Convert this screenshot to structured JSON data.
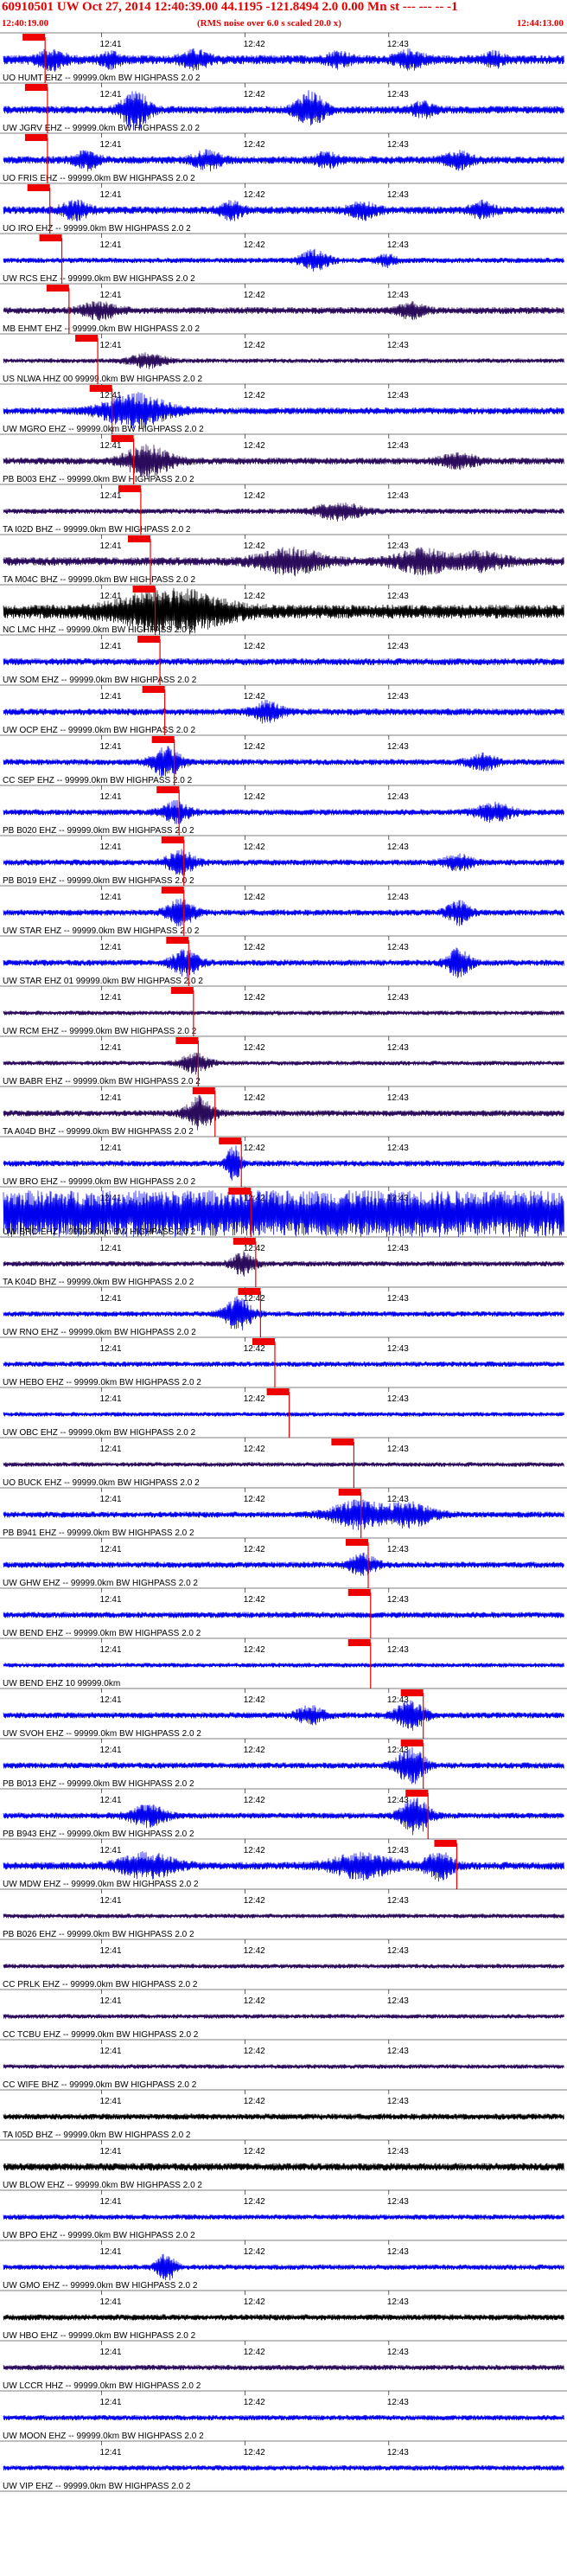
{
  "header": {
    "title": "60910501 UW Oct 27, 2014 12:40:39.00   44.1195 -121.8494  2.0 0.00 Mn st --- --- -- -1",
    "start_time": "12:40:19.00",
    "rms_note": "(RMS noise over 6.0 s scaled 20.0 x)",
    "end_time": "12:44:13.00"
  },
  "colors": {
    "blue_trace": "#0000ee",
    "purple_trace": "#2a0a5a",
    "black_trace": "#000000",
    "pick_red": "#ee0000",
    "label_text": "#000000"
  },
  "chart_data": {
    "type": "seismogram",
    "time_range": [
      "12:40:19.00",
      "12:44:13.00"
    ],
    "tick_labels": [
      "12:41",
      "12:42",
      "12:43"
    ],
    "tick_times_sec": [
      41,
      101,
      161
    ],
    "total_seconds": 234,
    "origin_time": "12:40:39.00",
    "traces": [
      {
        "label": "UO HUMT EHZ -- 99999.0km BW HIGHPASS  2.0  2",
        "color": "blue",
        "pick_sec": 8,
        "amplitude": 0.6,
        "bursts": [
          [
            20,
            6,
            1.0
          ],
          [
            45,
            4,
            0.8
          ],
          [
            80,
            6,
            0.9
          ],
          [
            140,
            5,
            0.8
          ],
          [
            170,
            6,
            0.9
          ],
          [
            205,
            4,
            0.7
          ]
        ]
      },
      {
        "label": "UW JGRV EHZ -- 99999.0km BW HIGHPASS  2.0  2",
        "color": "blue",
        "pick_sec": 9,
        "amplitude": 0.5,
        "bursts": [
          [
            55,
            6,
            2.2
          ],
          [
            128,
            6,
            2.2
          ],
          [
            175,
            5,
            0.8
          ]
        ]
      },
      {
        "label": "UO FRIS EHZ -- 99999.0km BW HIGHPASS  2.0  2",
        "color": "blue",
        "pick_sec": 9,
        "amplitude": 0.5,
        "bursts": [
          [
            35,
            5,
            1.0
          ],
          [
            85,
            6,
            1.0
          ],
          [
            135,
            5,
            0.8
          ],
          [
            190,
            6,
            0.9
          ]
        ]
      },
      {
        "label": "UO IRO EHZ -- 99999.0km BW HIGHPASS  2.0  2",
        "color": "blue",
        "pick_sec": 10,
        "amplitude": 0.5,
        "bursts": [
          [
            30,
            6,
            1.0
          ],
          [
            95,
            5,
            1.0
          ],
          [
            150,
            6,
            0.9
          ],
          [
            200,
            5,
            0.9
          ]
        ]
      },
      {
        "label": "UW RCS EHZ -- 99999.0km BW HIGHPASS  2.0  2",
        "color": "blue",
        "pick_sec": 15,
        "amplitude": 0.35,
        "bursts": [
          [
            130,
            6,
            1.2
          ],
          [
            160,
            4,
            0.7
          ]
        ]
      },
      {
        "label": "MB EHMT EHZ -- 99999.0km BW HIGHPASS  2.0  2",
        "color": "purple",
        "pick_sec": 18,
        "amplitude": 0.45,
        "bursts": [
          [
            40,
            8,
            0.9
          ],
          [
            170,
            6,
            0.8
          ]
        ]
      },
      {
        "label": "US NLWA HHZ 00 99999.0km BW HIGHPASS  2.0  2",
        "color": "purple",
        "pick_sec": 30,
        "amplitude": 0.3,
        "bursts": [
          [
            60,
            8,
            0.8
          ]
        ]
      },
      {
        "label": "UW MGRO EHZ -- 99999.0km BW HIGHPASS  2.0  2",
        "color": "blue",
        "pick_sec": 36,
        "amplitude": 0.45,
        "bursts": [
          [
            55,
            14,
            2.0
          ]
        ]
      },
      {
        "label": "PB B003 EHZ -- 99999.0km BW HIGHPASS  2.0  2",
        "color": "purple",
        "pick_sec": 45,
        "amplitude": 0.45,
        "bursts": [
          [
            60,
            10,
            1.8
          ],
          [
            190,
            8,
            0.8
          ]
        ]
      },
      {
        "label": "TA I02D BHZ -- 99999.0km BW HIGHPASS  2.0  2",
        "color": "purple",
        "pick_sec": 48,
        "amplitude": 0.35,
        "bursts": [
          [
            140,
            10,
            1.0
          ]
        ]
      },
      {
        "label": "TA M04C BHZ -- 99999.0km BW HIGHPASS  2.0  2",
        "color": "purple",
        "pick_sec": 52,
        "amplitude": 0.55,
        "bursts": [
          [
            120,
            14,
            1.4
          ],
          [
            175,
            12,
            1.3
          ],
          [
            200,
            10,
            1.0
          ]
        ]
      },
      {
        "label": "NC LMC HHZ -- 99999.0km BW HIGHPASS  2.0  2",
        "color": "black",
        "pick_sec": 54,
        "amplitude": 0.9,
        "bursts": [
          [
            70,
            22,
            2.4
          ]
        ]
      },
      {
        "label": "UW SOM EHZ -- 99999.0km BW HIGHPASS  2.0  2",
        "color": "blue",
        "pick_sec": 56,
        "amplitude": 0.45,
        "bursts": []
      },
      {
        "label": "UW OCP EHZ -- 99999.0km BW HIGHPASS  2.0  2",
        "color": "blue",
        "pick_sec": 58,
        "amplitude": 0.45,
        "bursts": [
          [
            110,
            6,
            1.2
          ]
        ]
      },
      {
        "label": "CC SEP EHZ -- 99999.0km BW HIGHPASS  2.0  2",
        "color": "blue",
        "pick_sec": 62,
        "amplitude": 0.4,
        "bursts": [
          [
            68,
            6,
            1.8
          ],
          [
            200,
            6,
            0.9
          ]
        ]
      },
      {
        "label": "PB B020 EHZ -- 99999.0km BW HIGHPASS  2.0  2",
        "color": "blue",
        "pick_sec": 64,
        "amplitude": 0.4,
        "bursts": [
          [
            72,
            6,
            1.2
          ],
          [
            205,
            8,
            1.0
          ]
        ]
      },
      {
        "label": "PB B019 EHZ -- 99999.0km BW HIGHPASS  2.0  2",
        "color": "blue",
        "pick_sec": 66,
        "amplitude": 0.4,
        "bursts": [
          [
            74,
            6,
            1.4
          ],
          [
            190,
            6,
            0.9
          ]
        ]
      },
      {
        "label": "UW STAR EHZ -- 99999.0km BW HIGHPASS  2.0  2",
        "color": "blue",
        "pick_sec": 66,
        "amplitude": 0.4,
        "bursts": [
          [
            74,
            6,
            1.5
          ],
          [
            190,
            5,
            1.4
          ]
        ]
      },
      {
        "label": "UW STAR EHZ 01 99999.0km BW HIGHPASS  2.0  2",
        "color": "blue",
        "pick_sec": 68,
        "amplitude": 0.4,
        "bursts": [
          [
            76,
            6,
            1.5
          ],
          [
            190,
            5,
            1.6
          ]
        ]
      },
      {
        "label": "UW RCM EHZ -- 99999.0km BW HIGHPASS  2.0  2",
        "color": "purple",
        "pick_sec": 70,
        "amplitude": 0.3,
        "bursts": []
      },
      {
        "label": "UW BABR EHZ -- 99999.0km BW HIGHPASS  2.0  2",
        "color": "purple",
        "pick_sec": 72,
        "amplitude": 0.3,
        "bursts": [
          [
            80,
            6,
            1.2
          ]
        ]
      },
      {
        "label": "TA A04D BHZ -- 99999.0km BW HIGHPASS  2.0  2",
        "color": "purple",
        "pick_sec": 79,
        "amplitude": 0.4,
        "bursts": [
          [
            82,
            6,
            2.0
          ]
        ]
      },
      {
        "label": "UW BRO EHZ -- 99999.0km BW HIGHPASS  2.0  2",
        "color": "blue",
        "pick_sec": 90,
        "amplitude": 0.4,
        "bursts": [
          [
            96,
            3,
            2.2
          ]
        ]
      },
      {
        "label": "UW BRO EHZ -- 99999.0km BW HIGHPASS  2.0  2",
        "color": "blue",
        "pick_sec": 94,
        "amplitude": 3.0,
        "bursts": []
      },
      {
        "label": "TA K04D BHZ -- 99999.0km BW HIGHPASS  2.0  2",
        "color": "purple",
        "pick_sec": 96,
        "amplitude": 0.35,
        "bursts": [
          [
            100,
            5,
            1.3
          ]
        ]
      },
      {
        "label": "UW RNO EHZ -- 99999.0km BW HIGHPASS  2.0  2",
        "color": "blue",
        "pick_sec": 98,
        "amplitude": 0.35,
        "bursts": [
          [
            98,
            6,
            2.0
          ]
        ]
      },
      {
        "label": "UW HEBO EHZ -- 99999.0km BW HIGHPASS  2.0  2",
        "color": "blue",
        "pick_sec": 104,
        "amplitude": 0.35,
        "bursts": []
      },
      {
        "label": "UW OBC EHZ -- 99999.0km BW HIGHPASS  2.0  2",
        "color": "blue",
        "pick_sec": 110,
        "amplitude": 0.3,
        "bursts": []
      },
      {
        "label": "UO BUCK EHZ -- 99999.0km BW HIGHPASS  2.0  2",
        "color": "purple",
        "pick_sec": 137,
        "amplitude": 0.3,
        "bursts": []
      },
      {
        "label": "PB B941 EHZ -- 99999.0km BW HIGHPASS  2.0  2",
        "color": "blue",
        "pick_sec": 140,
        "amplitude": 0.4,
        "bursts": [
          [
            148,
            12,
            1.6
          ],
          [
            170,
            10,
            1.4
          ]
        ]
      },
      {
        "label": "UW GHW EHZ -- 99999.0km BW HIGHPASS  2.0  2",
        "color": "blue",
        "pick_sec": 143,
        "amplitude": 0.4,
        "bursts": [
          [
            150,
            6,
            1.2
          ]
        ]
      },
      {
        "label": "UW BEND EHZ -- 99999.0km BW HIGHPASS  2.0  2",
        "color": "blue",
        "pick_sec": 144,
        "amplitude": 0.4,
        "bursts": []
      },
      {
        "label": "UW BEND EHZ 10 99999.0km",
        "color": "blue",
        "pick_sec": 144,
        "amplitude": 0.3,
        "bursts": []
      },
      {
        "label": "UW SVOH EHZ -- 99999.0km BW HIGHPASS  2.0  2",
        "color": "blue",
        "pick_sec": 166,
        "amplitude": 0.4,
        "bursts": [
          [
            128,
            6,
            1.0
          ],
          [
            170,
            6,
            1.8
          ]
        ]
      },
      {
        "label": "PB B013 EHZ -- 99999.0km BW HIGHPASS  2.0  2",
        "color": "blue",
        "pick_sec": 166,
        "amplitude": 0.4,
        "bursts": [
          [
            170,
            6,
            2.2
          ]
        ]
      },
      {
        "label": "PB B943 EHZ -- 99999.0km BW HIGHPASS  2.0  2",
        "color": "blue",
        "pick_sec": 168,
        "amplitude": 0.4,
        "bursts": [
          [
            60,
            8,
            1.2
          ],
          [
            172,
            6,
            2.2
          ]
        ]
      },
      {
        "label": "UW MDW EHZ -- 99999.0km BW HIGHPASS  2.0  2",
        "color": "blue",
        "pick_sec": 180,
        "amplitude": 0.5,
        "bursts": [
          [
            60,
            12,
            1.4
          ],
          [
            150,
            14,
            1.4
          ],
          [
            182,
            6,
            1.6
          ]
        ]
      },
      {
        "label": "PB B026 EHZ -- 99999.0km BW HIGHPASS  2.0  2",
        "color": "purple",
        "pick_sec": -1,
        "amplitude": 0.3,
        "bursts": []
      },
      {
        "label": "CC PRLK EHZ -- 99999.0km BW HIGHPASS  2.0  2",
        "color": "purple",
        "pick_sec": -1,
        "amplitude": 0.3,
        "bursts": []
      },
      {
        "label": "CC TCBU EHZ -- 99999.0km BW HIGHPASS  2.0  2",
        "color": "purple",
        "pick_sec": -1,
        "amplitude": 0.3,
        "bursts": []
      },
      {
        "label": "CC WIFE BHZ -- 99999.0km BW HIGHPASS  2.0  2",
        "color": "purple",
        "pick_sec": -1,
        "amplitude": 0.3,
        "bursts": []
      },
      {
        "label": "TA I05D BHZ -- 99999.0km BW HIGHPASS  2.0  2",
        "color": "black",
        "pick_sec": -1,
        "amplitude": 0.4,
        "bursts": []
      },
      {
        "label": "UW BLOW EHZ -- 99999.0km BW HIGHPASS  2.0  2",
        "color": "black",
        "pick_sec": -1,
        "amplitude": 0.5,
        "bursts": []
      },
      {
        "label": "UW BPO EHZ -- 99999.0km BW HIGHPASS  2.0  2",
        "color": "blue",
        "pick_sec": -1,
        "amplitude": 0.35,
        "bursts": []
      },
      {
        "label": "UW GMO EHZ -- 99999.0km BW HIGHPASS  2.0  2",
        "color": "blue",
        "pick_sec": -1,
        "amplitude": 0.35,
        "bursts": [
          [
            68,
            4,
            1.6
          ]
        ]
      },
      {
        "label": "UW HBO EHZ -- 99999.0km BW HIGHPASS  2.0  2",
        "color": "black",
        "pick_sec": -1,
        "amplitude": 0.4,
        "bursts": []
      },
      {
        "label": "UW LCCR HHZ -- 99999.0km BW HIGHPASS  2.0  2",
        "color": "purple",
        "pick_sec": -1,
        "amplitude": 0.35,
        "bursts": []
      },
      {
        "label": "UW MOON EHZ -- 99999.0km BW HIGHPASS  2.0  2",
        "color": "blue",
        "pick_sec": -1,
        "amplitude": 0.35,
        "bursts": []
      },
      {
        "label": "UW VIP EHZ -- 99999.0km BW HIGHPASS  2.0  2",
        "color": "blue",
        "pick_sec": -1,
        "amplitude": 0.35,
        "bursts": []
      }
    ]
  }
}
